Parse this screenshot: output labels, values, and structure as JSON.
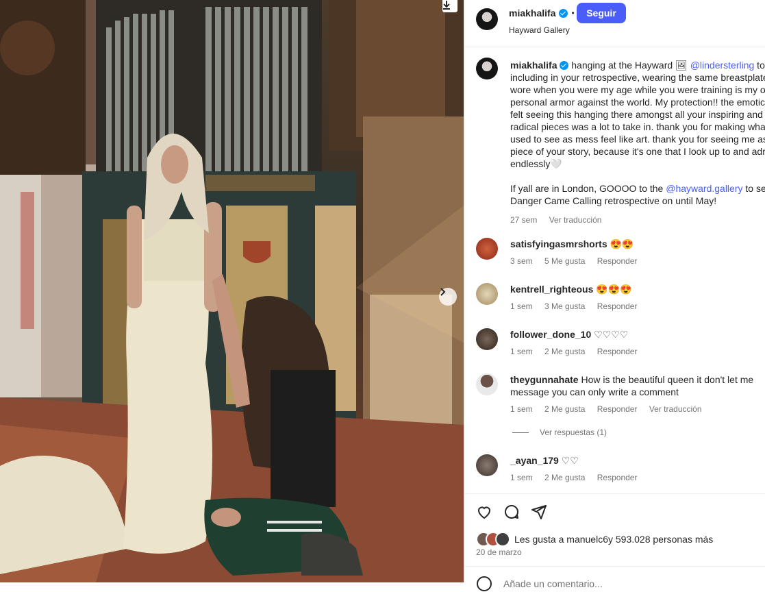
{
  "post": {
    "author": "miakhalifa",
    "follow_label": "Seguir",
    "dot": "•",
    "location": "Hayward Gallery"
  },
  "caption": {
    "author": "miakhalifa",
    "lines": [
      "hanging at the Hayward 🖼",
      "including in your retrospective, wearing the same breastplate",
      "wore when you were my age while you were training is my o",
      "personal armor against the world. My protection!! the emotic",
      "felt seeing this hanging there amongst all your inspiring and",
      "radical pieces was a lot to take in. thank you for making what",
      "used to see as mess feel like art. thank you for seeing me as",
      "piece of your story, because it's one that I look up to and adr",
      "endlessly🤍"
    ],
    "mention1": "@lindersterling",
    "mention1_after": " to",
    "p2_before": "If yall are in London, GOOOO to the ",
    "mention2": "@hayward.gallery",
    "mention2_after": " to see",
    "p2_line2": "Danger Came Calling retrospective on until May!",
    "time": "27 sem",
    "translate": "Ver traducción"
  },
  "comments": [
    {
      "user": "satisfyingasmrshorts",
      "text": "😍😍",
      "time": "3 sem",
      "likes": "5 Me gusta",
      "reply": "Responder",
      "color": "#b8402a"
    },
    {
      "user": "kentrell_righteous",
      "text": "😍😍😍",
      "time": "1 sem",
      "likes": "3 Me gusta",
      "reply": "Responder",
      "color": "#c9b48a"
    },
    {
      "user": "follower_done_10",
      "text": "♡♡♡♡",
      "time": "1 sem",
      "likes": "2 Me gusta",
      "reply": "Responder",
      "color": "#4a3c34"
    },
    {
      "user": "theygunnahate",
      "text": "How is the beautiful queen it don't let me",
      "text2": "message you can only write a comment",
      "time": "1 sem",
      "likes": "2 Me gusta",
      "reply": "Responder",
      "translate": "Ver traducción",
      "color": "#6b5a52"
    },
    {
      "user": "_ayan_179",
      "text": "♡♡",
      "time": "1 sem",
      "likes": "2 Me gusta",
      "reply": "Responder",
      "color": "#5a5450"
    }
  ],
  "replies_label": "Ver respuestas (1)",
  "likes": {
    "prefix": "Les gusta a ",
    "user": "manuelc6",
    "suffix": " y 593.028 personas más"
  },
  "date": "20 de marzo",
  "add_comment_placeholder": "Añade un comentario..."
}
